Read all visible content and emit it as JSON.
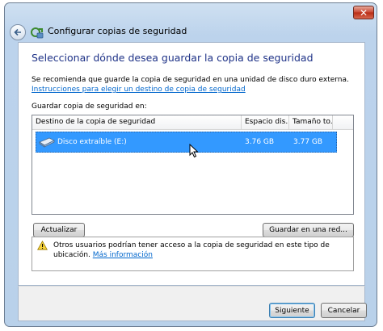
{
  "window": {
    "title": "Configurar copias de seguridad",
    "close_glyph": "✕",
    "close_icon": "close-icon",
    "back_icon": "back-arrow-icon"
  },
  "main": {
    "heading": "Seleccionar dónde desea guardar la copia de seguridad",
    "description_text": "Se recomienda que guarde la copia de seguridad en una unidad de disco duro externa. ",
    "description_link": "Instrucciones para elegir un destino de copia de seguridad",
    "save_label": "Guardar copia de seguridad en:"
  },
  "list": {
    "columns": [
      "Destino de la copia de seguridad",
      "Espacio dis...",
      "Tamaño to..."
    ],
    "rows": [
      {
        "name": "Disco extraíble (E:)",
        "free": "3.76 GB",
        "total": "3.77 GB",
        "selected": true,
        "icon": "removable-drive-icon"
      }
    ]
  },
  "buttons": {
    "refresh": "Actualizar",
    "save_network": "Guardar en una red...",
    "next": "Siguiente",
    "cancel": "Cancelar"
  },
  "warning": {
    "icon": "warning-icon",
    "text": "Otros usuarios podrían tener acceso a la copia de seguridad en este tipo de ubicación. ",
    "link": "Más información"
  },
  "colors": {
    "heading": "#1e3287",
    "link": "#0066cc",
    "selection": "#3399ff"
  }
}
